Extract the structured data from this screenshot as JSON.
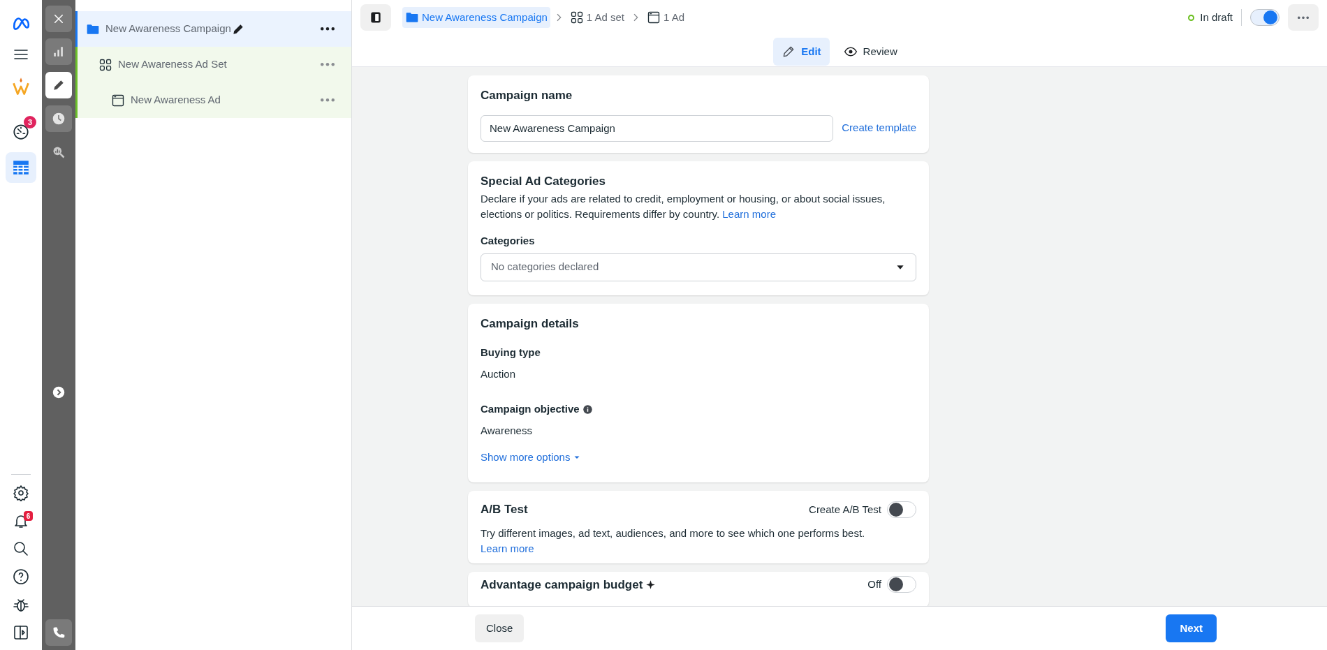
{
  "rail": {
    "nav_items": [
      {
        "badge": "3",
        "selected": false
      },
      {
        "selected": true
      }
    ],
    "bottom_items": [
      {
        "selected": false
      },
      {
        "badge": "6",
        "selected": false
      },
      {
        "selected": false
      },
      {
        "selected": false
      },
      {
        "selected": false
      },
      {
        "selected": false
      }
    ]
  },
  "strip": {
    "items": [
      {
        "selected": false,
        "disabled": false
      },
      {
        "selected": true,
        "disabled": false
      },
      {
        "selected": false,
        "disabled": false
      },
      {
        "selected": false,
        "disabled": true
      }
    ]
  },
  "tree": {
    "items": [
      {
        "label": "New Awareness Campaign",
        "selected": true,
        "children": [
          {
            "label": "New Awareness Ad Set",
            "selected": false,
            "children": [
              {
                "label": "New Awareness Ad",
                "selected": false
              }
            ]
          }
        ]
      }
    ]
  },
  "breadcrumb": [
    {
      "label": "New Awareness Campaign",
      "selected": true
    },
    {
      "label": "1 Ad set",
      "selected": false
    },
    {
      "label": "1 Ad",
      "selected": false
    }
  ],
  "status": {
    "label": "In draft",
    "color": "#6abf1e",
    "on": true
  },
  "view_tabs": [
    {
      "label": "Edit",
      "selected": true
    },
    {
      "label": "Review",
      "selected": false
    }
  ],
  "campaign_name": {
    "title": "Campaign name",
    "value": "New Awareness Campaign",
    "link": "Create template"
  },
  "special_ad_categories": {
    "title": "Special Ad Categories",
    "description": "Declare if your ads are related to credit, employment or housing, or about social issues, elections or politics. Requirements differ by country.",
    "link": "Learn more",
    "field_label": "Categories",
    "placeholder": "No categories declared"
  },
  "campaign_details": {
    "title": "Campaign details",
    "fields": [
      {
        "label": "Buying type",
        "value": "Auction",
        "info": false
      },
      {
        "label": "Campaign objective",
        "value": "Awareness",
        "info": true
      }
    ],
    "link": "Show more options"
  },
  "ab_test": {
    "title": "A/B Test",
    "toggle_label": "Create A/B Test",
    "on": false,
    "description": "Try different images, ad text, audiences, and more to see which one performs best.",
    "link": "Learn more"
  },
  "budget": {
    "title": "Advantage campaign budget",
    "toggle_label": "Off",
    "on": false
  },
  "footer": {
    "close": "Close",
    "next": "Next"
  }
}
